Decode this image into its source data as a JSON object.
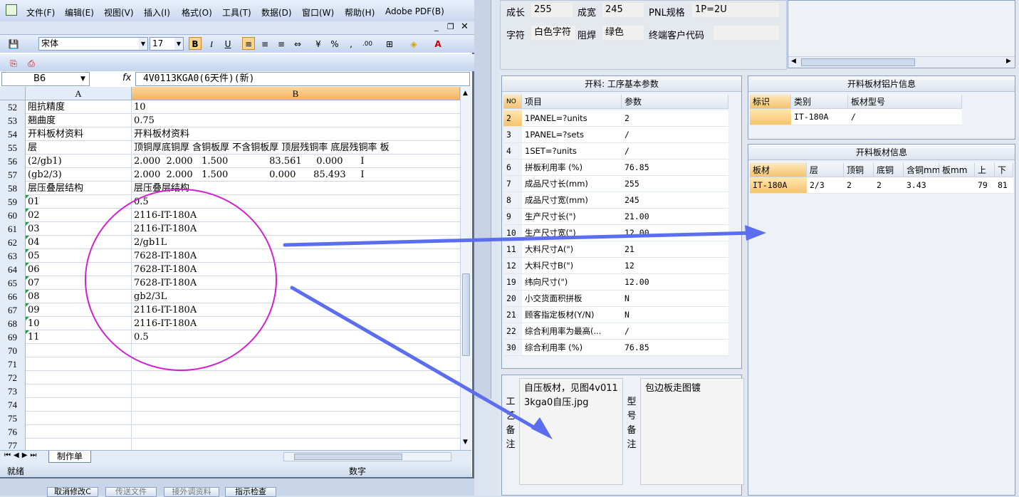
{
  "excel": {
    "menu": [
      "文件(F)",
      "编辑(E)",
      "视图(V)",
      "插入(I)",
      "格式(O)",
      "工具(T)",
      "数据(D)",
      "窗口(W)",
      "帮助(H)",
      "Adobe PDF(B)"
    ],
    "font_name": "宋体",
    "font_size": "17",
    "name_box": "B6",
    "fx": "fx",
    "formula": "4V0113KGA0(6天件)(新)",
    "col_a": "A",
    "col_b": "B",
    "rows": [
      {
        "n": "52",
        "a": "阻抗精度",
        "b": "10"
      },
      {
        "n": "53",
        "a": "翘曲度",
        "b": "0.75"
      },
      {
        "n": "54",
        "a": "开料板材资料",
        "b": "开料板材资料"
      },
      {
        "n": "55",
        "a": "层",
        "b": "顶铜厚底铜厚 含铜板厚 不含铜板厚 顶层残铜率 底层残铜率 板"
      },
      {
        "n": "56",
        "a": "(2/gb1)",
        "b": "2.000  2.000   1.500              83.561     0.000      I"
      },
      {
        "n": "57",
        "a": "(gb2/3)",
        "b": "2.000  2.000   1.500              0.000      85.493     I"
      },
      {
        "n": "58",
        "a": "层压叠层结构",
        "b": "层压叠层结构"
      },
      {
        "n": "59",
        "a": "01",
        "b": "0.5"
      },
      {
        "n": "60",
        "a": "02",
        "b": "2116-IT-180A"
      },
      {
        "n": "61",
        "a": "03",
        "b": "2116-IT-180A"
      },
      {
        "n": "62",
        "a": "04",
        "b": "2/gb1L"
      },
      {
        "n": "63",
        "a": "05",
        "b": "7628-IT-180A"
      },
      {
        "n": "64",
        "a": "06",
        "b": "7628-IT-180A"
      },
      {
        "n": "65",
        "a": "07",
        "b": "7628-IT-180A"
      },
      {
        "n": "66",
        "a": "08",
        "b": "gb2/3L"
      },
      {
        "n": "67",
        "a": "09",
        "b": "2116-IT-180A"
      },
      {
        "n": "68",
        "a": "10",
        "b": "2116-IT-180A"
      },
      {
        "n": "69",
        "a": "11",
        "b": "0.5"
      },
      {
        "n": "70",
        "a": "",
        "b": ""
      },
      {
        "n": "71",
        "a": "",
        "b": ""
      },
      {
        "n": "72",
        "a": "",
        "b": ""
      },
      {
        "n": "73",
        "a": "",
        "b": ""
      },
      {
        "n": "74",
        "a": "",
        "b": ""
      },
      {
        "n": "75",
        "a": "",
        "b": ""
      },
      {
        "n": "76",
        "a": "",
        "b": ""
      },
      {
        "n": "77",
        "a": "",
        "b": ""
      }
    ],
    "sheet_tab": "制作单",
    "status_ready": "就绪",
    "status_num": "数字"
  },
  "app": {
    "top": {
      "l_growth": "成长",
      "v_growth": "255",
      "l_width": "成宽",
      "v_width": "245",
      "l_pnl": "PNL规格",
      "v_pnl": "1P=2U",
      "l_char": "字符",
      "v_char": "白色字符",
      "l_mask": "阻焊",
      "v_mask": "绿色",
      "l_cust": "终端客户代码",
      "v_cust": ""
    },
    "params": {
      "title": "开料: 工序基本参数",
      "h_no": "NO",
      "h_item": "项目",
      "h_param": "参数",
      "rows": [
        {
          "no": "2",
          "item": "1PANEL=?units",
          "val": "2"
        },
        {
          "no": "3",
          "item": "1PANEL=?sets",
          "val": "/"
        },
        {
          "no": "4",
          "item": "1SET=?units",
          "val": "/"
        },
        {
          "no": "6",
          "item": "拼板利用率 (%)",
          "val": "76.85"
        },
        {
          "no": "7",
          "item": "成品尺寸长(mm)",
          "val": "255"
        },
        {
          "no": "8",
          "item": "成品尺寸宽(mm)",
          "val": "245"
        },
        {
          "no": "9",
          "item": "生产尺寸长(\")",
          "val": "21.00"
        },
        {
          "no": "10",
          "item": "生产尺寸宽(\")",
          "val": "12.00"
        },
        {
          "no": "11",
          "item": "大料尺寸A(\")",
          "val": "21"
        },
        {
          "no": "12",
          "item": "大料尺寸B(\")",
          "val": "12"
        },
        {
          "no": "19",
          "item": "纬向尺寸(\")",
          "val": "12.00"
        },
        {
          "no": "20",
          "item": "小交货面积拼板",
          "val": "N"
        },
        {
          "no": "21",
          "item": "顾客指定板材(Y/N)",
          "val": "N"
        },
        {
          "no": "22",
          "item": "综合利用率为最高(...",
          "val": "/"
        },
        {
          "no": "30",
          "item": "综合利用率 (%)",
          "val": "76.85"
        }
      ]
    },
    "foil": {
      "title": "开料板材铝片信息",
      "h_mark": "标识",
      "h_type": "类别",
      "h_model": "板材型号",
      "row": {
        "mark": "",
        "type": "IT-180A",
        "model": "/"
      }
    },
    "sheet": {
      "title": "开料板材信息",
      "headers": [
        "板材",
        "层",
        "顶铜",
        "底铜",
        "含铜mm",
        "板mm",
        "上",
        "下"
      ],
      "row": [
        "IT-180A",
        "2/3",
        "2",
        "2",
        "3.43",
        "",
        "79",
        "81"
      ]
    },
    "memo": {
      "label1": [
        "工",
        "艺",
        "备",
        "注"
      ],
      "text1": "自压板材，见图4v0113kga0自压.jpg",
      "label2": [
        "型",
        "号",
        "备",
        "注"
      ],
      "text2": "包边板走图镀"
    },
    "buttons": [
      "取消修改C",
      "传送文件",
      "接外调资料",
      "指示检查"
    ],
    "colors": {
      "annotation_circle": "#d21fd0",
      "arrow": "#5c6ef0",
      "selected": "#f8c36c"
    }
  }
}
